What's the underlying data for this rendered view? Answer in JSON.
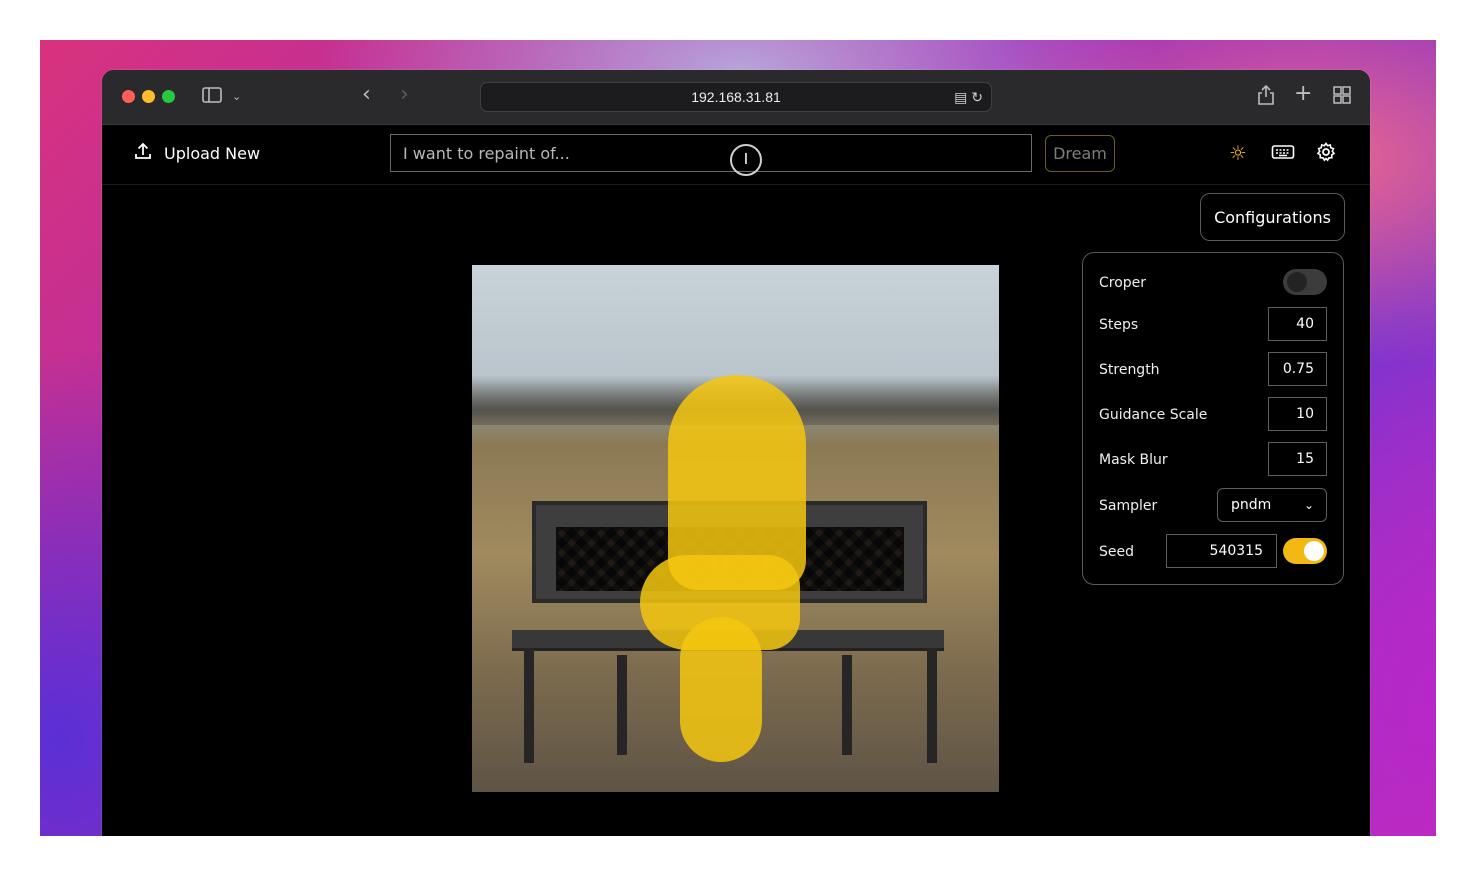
{
  "browser": {
    "address": "192.168.31.81"
  },
  "toolbar": {
    "upload_label": "Upload New",
    "prompt_placeholder": "I want to repaint of...",
    "dream_label": "Dream"
  },
  "config": {
    "button_label": "Configurations",
    "croper": {
      "label": "Croper",
      "enabled": false
    },
    "steps": {
      "label": "Steps",
      "value": "40"
    },
    "strength": {
      "label": "Strength",
      "value": "0.75"
    },
    "guidance": {
      "label": "Guidance Scale",
      "value": "10"
    },
    "mask_blur": {
      "label": "Mask Blur",
      "value": "15"
    },
    "sampler": {
      "label": "Sampler",
      "value": "pndm"
    },
    "seed": {
      "label": "Seed",
      "value": "540315",
      "fixed": true
    }
  },
  "colors": {
    "accent": "#f1b911",
    "mask": "#f5c70f",
    "background": "#000000"
  },
  "icons": {
    "upload": "upload-icon",
    "theme": "sun-icon",
    "keyboard": "keyboard-icon",
    "settings": "gear-icon"
  }
}
